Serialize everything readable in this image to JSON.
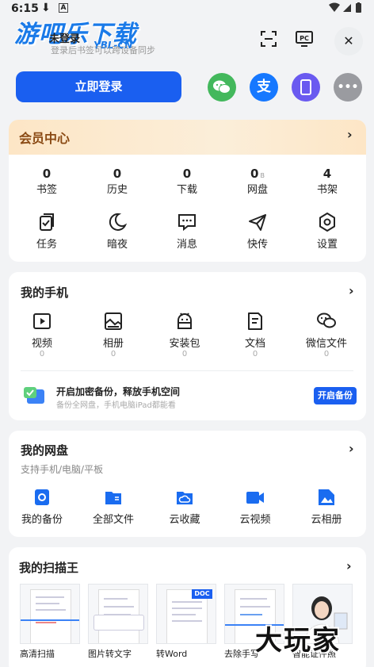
{
  "status_bar": {
    "time": "6:15",
    "download_glyph": "⬇",
    "a_glyph": "A"
  },
  "header": {
    "logo": "游吧乐下载",
    "logo_sub": "YBL-CN",
    "login_title": "未登录",
    "login_hint": "登录后书签可以跨设备同步",
    "scan_icon": "scan-icon",
    "pc_icon": "pc-icon",
    "pc_label": "PC",
    "close_label": "✕"
  },
  "login": {
    "button_label": "立即登录",
    "providers": [
      {
        "name": "wechat",
        "glyph": "💬",
        "color": "#43b85c"
      },
      {
        "name": "alipay",
        "glyph": "支",
        "color": "#1678ff"
      },
      {
        "name": "phone",
        "glyph": "▯",
        "color": "#6a5af0"
      },
      {
        "name": "more",
        "glyph": "•••",
        "color": "#9a9ba0"
      }
    ]
  },
  "vip": {
    "title": "会员中心",
    "chevron": "›"
  },
  "stats": [
    {
      "value": "0",
      "label": "书签"
    },
    {
      "value": "0",
      "label": "历史"
    },
    {
      "value": "0",
      "label": "下载"
    },
    {
      "value": "0",
      "unit": "B",
      "label": "网盘"
    },
    {
      "value": "4",
      "label": "书架"
    }
  ],
  "quick": [
    {
      "label": "任务",
      "icon": "task-icon"
    },
    {
      "label": "暗夜",
      "icon": "moon-icon"
    },
    {
      "label": "消息",
      "icon": "message-icon"
    },
    {
      "label": "快传",
      "icon": "send-icon"
    },
    {
      "label": "设置",
      "icon": "settings-icon"
    }
  ],
  "phone": {
    "title": "我的手机",
    "chevron": "›",
    "items": [
      {
        "label": "视频",
        "count": "0",
        "icon": "video-icon"
      },
      {
        "label": "相册",
        "count": "0",
        "icon": "album-icon"
      },
      {
        "label": "安装包",
        "count": "0",
        "icon": "android-icon"
      },
      {
        "label": "文档",
        "count": "0",
        "icon": "document-icon"
      },
      {
        "label": "微信文件",
        "count": "0",
        "icon": "wechat-file-icon"
      }
    ],
    "backup_title": "开启加密备份，释放手机空间",
    "backup_desc": "备份全网盘，手机电脑iPad都能看",
    "backup_button": "开启备份"
  },
  "cloud": {
    "title": "我的网盘",
    "subtitle": "支持手机/电脑/平板",
    "chevron": "›",
    "items": [
      {
        "label": "我的备份",
        "icon": "backup-icon"
      },
      {
        "label": "全部文件",
        "icon": "folder-icon"
      },
      {
        "label": "云收藏",
        "icon": "cloud-collect-icon"
      },
      {
        "label": "云视频",
        "icon": "cloud-video-icon"
      },
      {
        "label": "云相册",
        "icon": "cloud-album-icon"
      }
    ]
  },
  "scanner": {
    "title": "我的扫描王",
    "chevron": "›",
    "items": [
      {
        "label": "高清扫描"
      },
      {
        "label": "图片转文字"
      },
      {
        "label": "转Word",
        "badge": "DOC"
      },
      {
        "label": "去除手写"
      },
      {
        "label": "智能证件照"
      }
    ]
  },
  "watermark": "大玩家"
}
